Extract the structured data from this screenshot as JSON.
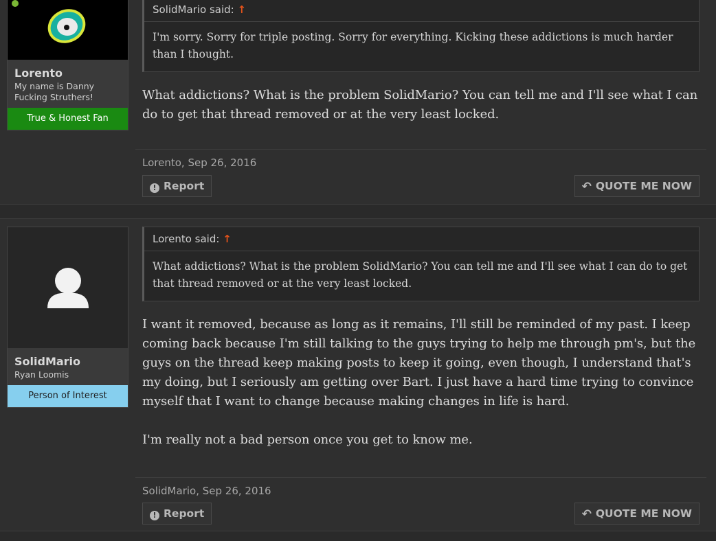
{
  "posts": [
    {
      "username": "Lorento",
      "user_title": "My name is Danny Fucking Struthers!",
      "banner": "True & Honest Fan",
      "quote_author": "SolidMario said:",
      "quote_arrow": "↑",
      "quote_text": "I'm sorry. Sorry for triple posting. Sorry for everything. Kicking these addictions is much harder than I thought.",
      "message": [
        "What addictions? What is the problem SolidMario? You can tell me and I'll see what I can do to get that thread removed or at the very least locked."
      ],
      "meta": "Lorento, Sep 26, 2016",
      "report_label": "Report",
      "quote_button_label": "QUOTE ME NOW"
    },
    {
      "username": "SolidMario",
      "user_title": "Ryan Loomis",
      "banner": "Person of Interest",
      "quote_author": "Lorento said:",
      "quote_arrow": "↑",
      "quote_text": "What addictions? What is the problem SolidMario? You can tell me and I'll see what I can do to get that thread removed or at the very least locked.",
      "message": [
        "I want it removed, because as long as it remains, I'll still be reminded of my past. I keep coming back because I'm still talking to the guys trying to help me through pm's, but the guys on the thread keep making posts to keep it going, even though, I understand that's my doing, but I seriously am getting over Bart. I just have a hard time trying to convince myself that I want to change because making changes in life is hard.",
        "I'm really not a bad person once you get to know me."
      ],
      "meta": "SolidMario, Sep 26, 2016",
      "report_label": "Report",
      "quote_button_label": "QUOTE ME NOW"
    }
  ],
  "icons": {
    "report": "exclamation-circle-icon",
    "quote": "reply-arrow-icon",
    "avatar1": "eye-logo-avatar",
    "avatar2": "default-person-avatar"
  },
  "colors": {
    "banner_green": "#1a8a12",
    "banner_blue": "#86cfee",
    "quote_arrow": "#e2521b"
  }
}
